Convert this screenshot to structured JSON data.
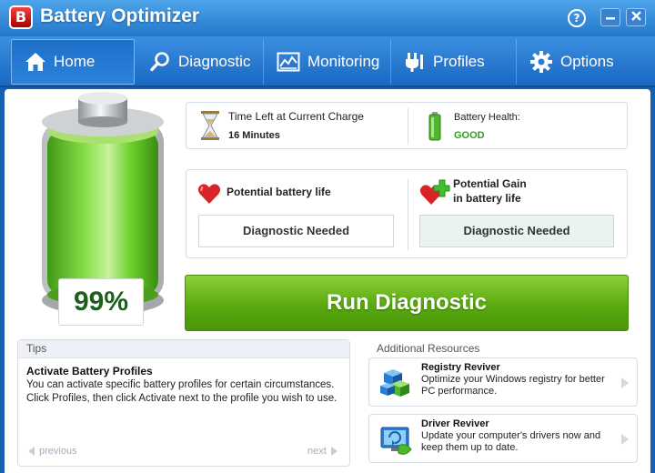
{
  "app": {
    "title": "Battery Optimizer",
    "logo_letter": "B"
  },
  "window": {
    "help": "?",
    "minimize": "▬",
    "close": "✕"
  },
  "nav": {
    "tabs": [
      {
        "label": "Home",
        "icon": "home-icon",
        "active": true
      },
      {
        "label": "Diagnostic",
        "icon": "magnifier-icon"
      },
      {
        "label": "Monitoring",
        "icon": "monitor-chart-icon"
      },
      {
        "label": "Profiles",
        "icon": "plug-icon"
      },
      {
        "label": "Options",
        "icon": "gear-icon"
      }
    ]
  },
  "battery": {
    "percent_label": "99%",
    "level": 0.99,
    "colors": {
      "fill": "#6ad22a",
      "fill_dark": "#3f9a14"
    }
  },
  "status": {
    "time_left_label": "Time Left at Current Charge",
    "time_left_value": "16 Minutes",
    "health_label": "Battery Health:",
    "health_value": "GOOD",
    "health_color": "#2e9e1d"
  },
  "life": {
    "potential_label": "Potential battery life",
    "potential_value": "Diagnostic Needed",
    "gain_label_line1": "Potential Gain",
    "gain_label_line2": "in battery life",
    "gain_value": "Diagnostic Needed"
  },
  "run_button": {
    "label": "Run Diagnostic",
    "color": "#5aa90f"
  },
  "tips": {
    "header": "Tips",
    "title": "Activate Battery Profiles",
    "text": "You can activate specific battery profiles for certain circumstances. Click Profiles, then click Activate next to the profile you wish to use.",
    "previous": "previous",
    "next": "next"
  },
  "resources": {
    "header": "Additional Resources",
    "items": [
      {
        "title": "Registry Reviver",
        "desc": "Optimize your Windows registry for better PC performance.",
        "icon": "registry-cubes-icon"
      },
      {
        "title": "Driver Reviver",
        "desc": "Update your computer's drivers now and keep them up to date.",
        "icon": "driver-monitor-icon"
      }
    ]
  }
}
